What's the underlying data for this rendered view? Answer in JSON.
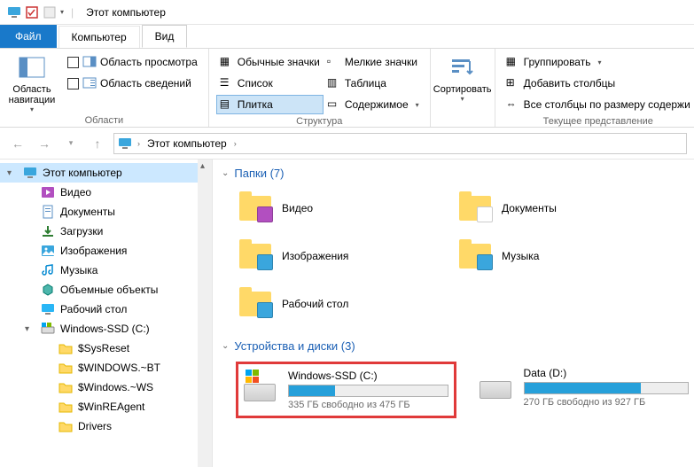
{
  "titlebar": {
    "title": "Этот компьютер"
  },
  "tabs": {
    "file": "Файл",
    "computer": "Компьютер",
    "view": "Вид"
  },
  "ribbon": {
    "group_regions": {
      "label": "Области",
      "nav_panel": "Область навигации",
      "preview": "Область просмотра",
      "details": "Область сведений"
    },
    "group_layout": {
      "label": "Структура",
      "items": {
        "regular": "Обычные значки",
        "small": "Мелкие значки",
        "list": "Список",
        "table": "Таблица",
        "tile": "Плитка",
        "content": "Содержимое"
      }
    },
    "group_sort": {
      "label": "",
      "sort": "Сортировать"
    },
    "group_view": {
      "label": "Текущее представление",
      "group_by": "Группировать",
      "add_cols": "Добавить столбцы",
      "fit_cols": "Все столбцы по размеру содержи"
    }
  },
  "addr": {
    "root": "Этот компьютер"
  },
  "sidebar": {
    "items": [
      {
        "label": "Этот компьютер",
        "icon": "pc",
        "lvl": 1,
        "sel": true,
        "exp": "▾"
      },
      {
        "label": "Видео",
        "icon": "video",
        "lvl": 2
      },
      {
        "label": "Документы",
        "icon": "doc",
        "lvl": 2
      },
      {
        "label": "Загрузки",
        "icon": "down",
        "lvl": 2
      },
      {
        "label": "Изображения",
        "icon": "img",
        "lvl": 2
      },
      {
        "label": "Музыка",
        "icon": "music",
        "lvl": 2
      },
      {
        "label": "Объемные объекты",
        "icon": "3d",
        "lvl": 2
      },
      {
        "label": "Рабочий стол",
        "icon": "desk",
        "lvl": 2
      },
      {
        "label": "Windows-SSD (C:)",
        "icon": "hdd",
        "lvl": 2,
        "exp": "▾"
      },
      {
        "label": "$SysReset",
        "icon": "folder",
        "lvl": 3
      },
      {
        "label": "$WINDOWS.~BT",
        "icon": "folder",
        "lvl": 3
      },
      {
        "label": "$Windows.~WS",
        "icon": "folder",
        "lvl": 3
      },
      {
        "label": "$WinREAgent",
        "icon": "folder",
        "lvl": 3
      },
      {
        "label": "Drivers",
        "icon": "folder",
        "lvl": 3
      }
    ]
  },
  "content": {
    "folders_hdr": "Папки (7)",
    "drives_hdr": "Устройства и диски (3)",
    "folders": [
      {
        "label": "Видео",
        "badge": "#b24fc0"
      },
      {
        "label": "Документы",
        "badge": "#ffffff"
      },
      {
        "label": "Изображения",
        "badge": "#3aa6dd"
      },
      {
        "label": "Музыка",
        "badge": "#3aa6dd"
      },
      {
        "label": "Рабочий стол",
        "badge": "#3aa6dd"
      }
    ],
    "drives": [
      {
        "name": "Windows-SSD (C:)",
        "free": "335 ГБ свободно из 475 ГБ",
        "fill": 29,
        "win": true,
        "hl": true
      },
      {
        "name": "Data (D:)",
        "free": "270 ГБ свободно из 927 ГБ",
        "fill": 71,
        "win": false,
        "hl": false
      }
    ]
  }
}
